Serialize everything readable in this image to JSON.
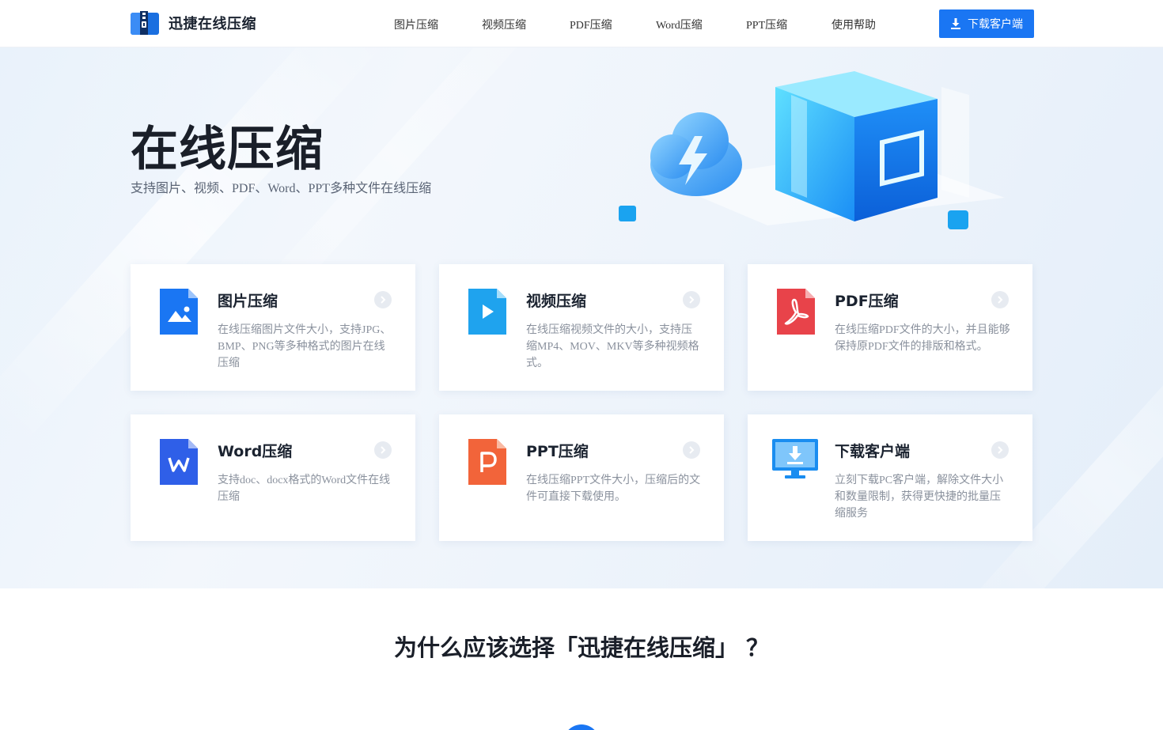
{
  "header": {
    "logo_text": "迅捷在线压缩",
    "nav": [
      {
        "label": "图片压缩"
      },
      {
        "label": "视频压缩"
      },
      {
        "label": "PDF压缩"
      },
      {
        "label": "Word压缩"
      },
      {
        "label": "PPT压缩"
      },
      {
        "label": "使用帮助"
      }
    ],
    "download_label": "下载客户端"
  },
  "hero": {
    "title": "在线压缩",
    "subtitle": "支持图片、视频、PDF、Word、PPT多种文件在线压缩"
  },
  "cards": [
    {
      "title": "图片压缩",
      "desc": "在线压缩图片文件大小，支持JPG、BMP、PNG等多种格式的图片在线压缩",
      "icon": "image-file-icon",
      "color": "#1a76f3"
    },
    {
      "title": "视频压缩",
      "desc": "在线压缩视频文件的大小，支持压缩MP4、MOV、MKV等多种视频格式。",
      "icon": "video-file-icon",
      "color": "#1fa3ee"
    },
    {
      "title": "PDF压缩",
      "desc": "在线压缩PDF文件的大小，并且能够保持原PDF文件的排版和格式。",
      "icon": "pdf-file-icon",
      "color": "#e8434a"
    },
    {
      "title": "Word压缩",
      "desc": "支持doc、docx格式的Word文件在线压缩",
      "icon": "word-file-icon",
      "color": "#2f5fe8"
    },
    {
      "title": "PPT压缩",
      "desc": "在线压缩PPT文件大小，压缩后的文件可直接下载使用。",
      "icon": "ppt-file-icon",
      "color": "#f2643a"
    },
    {
      "title": "下载客户端",
      "desc": "立刻下载PC客户端，解除文件大小和数量限制，获得更快捷的批量压缩服务",
      "icon": "monitor-download-icon",
      "color": "#1a8df0"
    }
  ],
  "why": {
    "title": "为什么应该选择「迅捷在线压缩」 ？"
  }
}
